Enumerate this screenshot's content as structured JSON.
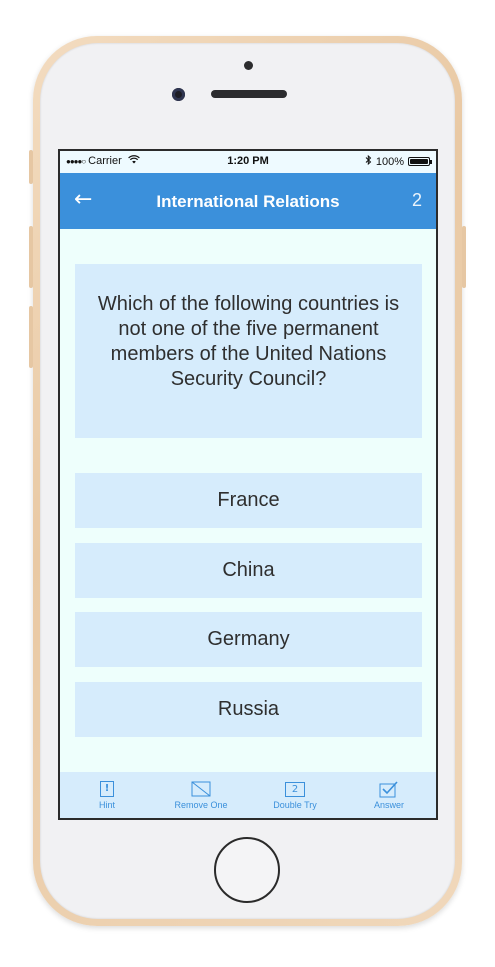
{
  "status_bar": {
    "signal": "●●●●○",
    "carrier": "Carrier",
    "wifi_icon": "wifi-icon",
    "time": "1:20 PM",
    "bluetooth_icon": "bluetooth-icon",
    "battery": "100%"
  },
  "nav": {
    "back_icon": "←",
    "title": "International Relations",
    "count": "2"
  },
  "question": {
    "text": "Which of the following countries is not one of the five permanent members of the United Nations Security Council?"
  },
  "answers": [
    {
      "label": "France"
    },
    {
      "label": "China"
    },
    {
      "label": "Germany"
    },
    {
      "label": "Russia"
    }
  ],
  "toolbar": {
    "hint": {
      "label": "Hint",
      "icon": "hint-icon",
      "glyph": "!"
    },
    "remove_one": {
      "label": "Remove One",
      "icon": "remove-one-icon"
    },
    "double_try": {
      "label": "Double Try",
      "icon": "double-try-icon",
      "glyph": "2"
    },
    "answer": {
      "label": "Answer",
      "icon": "checkbox-icon"
    }
  },
  "colors": {
    "accent": "#3b90db",
    "card": "#d6ecfc",
    "background": "#eefffc"
  }
}
